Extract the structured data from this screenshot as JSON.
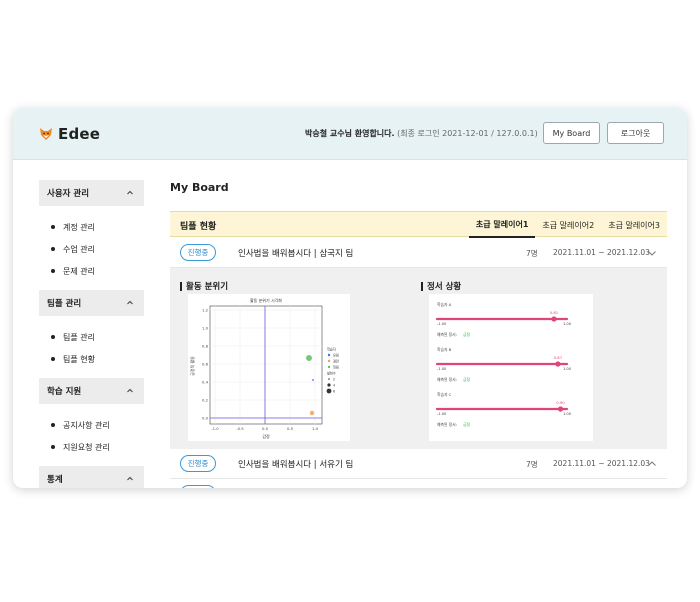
{
  "app": {
    "name": "Edee"
  },
  "header": {
    "welcome_name": "박승철 교수님 환영합니다.",
    "last_login": "(최종 로그인 2021-12-01 / 127.0.0.1)",
    "myboard_label": "My Board",
    "logout_label": "로그아웃"
  },
  "sidebar": {
    "sections": [
      {
        "title": "사용자 관리",
        "items": [
          "계정 관리",
          "수업 관리",
          "문제 관리"
        ]
      },
      {
        "title": "팀플 관리",
        "items": [
          "팀플 관리",
          "팀플 현황"
        ]
      },
      {
        "title": "학습 지원",
        "items": [
          "공지사항 관리",
          "지원요청 관리"
        ]
      },
      {
        "title": "통계",
        "items": []
      }
    ]
  },
  "main": {
    "title": "My Board",
    "team_status_title": "팀플 현황",
    "tabs": [
      "초급 말레이어1",
      "초급 말레이어2",
      "초급 말레이어3"
    ],
    "active_tab": 0,
    "rows": [
      {
        "status": "진행중",
        "title": "인사법을 배워봅시다 | 삼국지 팀",
        "count": "7명",
        "date": "2021.11.01 ~ 2021.12.03",
        "expanded": false
      },
      {
        "status": "진행중",
        "title": "인사법을 배워봅시다 | 서유기 팀",
        "count": "7명",
        "date": "2021.11.01 ~ 2021.12.03",
        "expanded": true
      }
    ],
    "activity_label": "활동 분위기",
    "emotion_label": "정서 상황"
  },
  "scatter": {
    "title": "활동 분위기 시각화",
    "xlabel": "감정",
    "ylabel": "긍정적 활동",
    "xticks": [
      "-1.0",
      "-0.5",
      "0.0",
      "0.5",
      "1.0"
    ],
    "yticks": [
      "1.2",
      "1.0",
      "0.8",
      "0.6",
      "0.4",
      "0.2",
      "0.0"
    ],
    "legend": [
      "학습자",
      "유림",
      "경란",
      "월림",
      "발화수",
      "2",
      "4",
      "6"
    ],
    "colors": {
      "blue": "#3b6fd6",
      "orange": "#f0a050",
      "green": "#5cc060",
      "purple": "#8a7ad8"
    }
  },
  "emotion": {
    "rows": [
      {
        "name": "학습자 A",
        "value": "0.81",
        "min": "-1.00",
        "max": "1.00",
        "fraction": 0.9,
        "note_label": "예측된 정서:",
        "note_value": "긍정"
      },
      {
        "name": "학습자 B",
        "value": "0.87",
        "min": "-1.00",
        "max": "1.00",
        "fraction": 0.93,
        "note_label": "예측된 정서:",
        "note_value": "긍정"
      },
      {
        "name": "학습자 C",
        "value": "0.90",
        "min": "-1.00",
        "max": "1.00",
        "fraction": 0.95,
        "note_label": "예측된 정서:",
        "note_value": "긍정"
      }
    ],
    "colors": {
      "bar": "#e0457a",
      "positive": "#3aaa4a"
    }
  }
}
